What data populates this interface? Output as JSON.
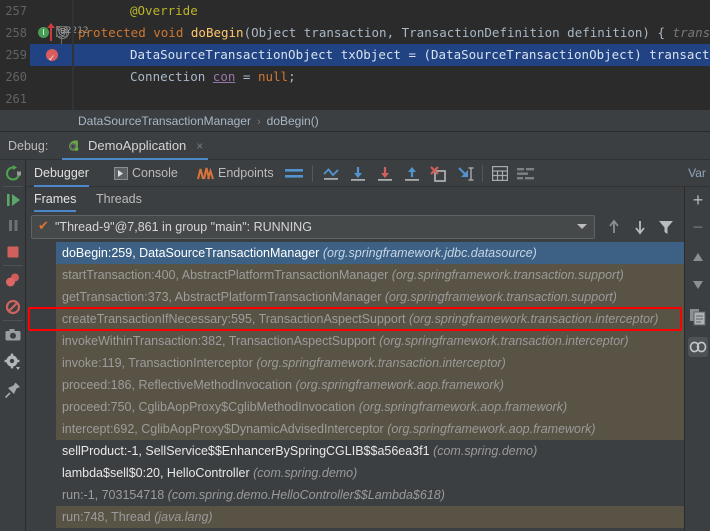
{
  "editor": {
    "lines": [
      {
        "num": "257",
        "segments": [
          {
            "cls": "ann",
            "text": "@Override"
          }
        ],
        "indent": 52
      },
      {
        "num": "258",
        "segments": [
          {
            "cls": "kw",
            "text": "protected void "
          },
          {
            "cls": "mth",
            "text": "doBegin"
          },
          {
            "cls": "pln",
            "text": "(Object transaction, TransactionDefinition definition) { "
          },
          {
            "cls": "hint",
            "text": " transa"
          }
        ],
        "indent": 0
      },
      {
        "num": "259",
        "segments": [
          {
            "cls": "pln",
            "text": "DataSourceTransactionObject txObject = (DataSourceTransactionObject) transaction;"
          }
        ],
        "indent": 22
      },
      {
        "num": "260",
        "segments": [
          {
            "cls": "pln",
            "text": "Connection "
          },
          {
            "cls": "fld",
            "text": "con"
          },
          {
            "cls": "pln",
            "text": " = "
          },
          {
            "cls": "kw",
            "text": "null"
          },
          {
            "cls": "pln",
            "text": ";"
          }
        ],
        "indent": 22
      },
      {
        "num": "261",
        "segments": [],
        "indent": 22
      }
    ]
  },
  "breadcrumb": {
    "class_name": "DataSourceTransactionManager",
    "separator": "›",
    "method_name": "doBegin()"
  },
  "debug_bar": {
    "label": "Debug:",
    "run_config": "DemoApplication",
    "close_glyph": "×"
  },
  "tabs": {
    "main": [
      {
        "label": "Debugger",
        "active": true
      },
      {
        "label": "Console",
        "active": false
      },
      {
        "label": "Endpoints",
        "active": false
      }
    ],
    "sub": [
      {
        "label": "Frames",
        "active": true
      },
      {
        "label": "Threads",
        "active": false
      }
    ],
    "variables_header": "Var"
  },
  "thread_selector": {
    "value": "\"Thread-9\"@7,861 in group \"main\": RUNNING",
    "check_glyph": "✔"
  },
  "frames": [
    {
      "method": "doBegin:259, DataSourceTransactionManager",
      "package": "(org.springframework.jdbc.datasource)",
      "state": "selected"
    },
    {
      "method": "startTransaction:400, AbstractPlatformTransactionManager",
      "package": "(org.springframework.transaction.support)",
      "state": "lib"
    },
    {
      "method": "getTransaction:373, AbstractPlatformTransactionManager",
      "package": "(org.springframework.transaction.support)",
      "state": "lib"
    },
    {
      "method": "createTransactionIfNecessary:595, TransactionAspectSupport",
      "package": "(org.springframework.transaction.interceptor)",
      "state": "lib"
    },
    {
      "method": "invokeWithinTransaction:382, TransactionAspectSupport",
      "package": "(org.springframework.transaction.interceptor)",
      "state": "lib"
    },
    {
      "method": "invoke:119, TransactionInterceptor",
      "package": "(org.springframework.transaction.interceptor)",
      "state": "lib"
    },
    {
      "method": "proceed:186, ReflectiveMethodInvocation",
      "package": "(org.springframework.aop.framework)",
      "state": "lib"
    },
    {
      "method": "proceed:750, CglibAopProxy$CglibMethodInvocation",
      "package": "(org.springframework.aop.framework)",
      "state": "lib"
    },
    {
      "method": "intercept:692, CglibAopProxy$DynamicAdvisedInterceptor",
      "package": "(org.springframework.aop.framework)",
      "state": "lib"
    },
    {
      "method": "sellProduct:-1, SellService$$EnhancerBySpringCGLIB$$a56ea3f1",
      "package": "(com.spring.demo)",
      "state": "user"
    },
    {
      "method": "lambda$sell$0:20, HelloController",
      "package": "(com.spring.demo)",
      "state": "user"
    },
    {
      "method": "run:-1, 703154718",
      "package": "(com.spring.demo.HelloController$$Lambda$618)",
      "state": "user"
    },
    {
      "method": "run:748, Thread",
      "package": "(java.lang)",
      "state": "lib"
    }
  ],
  "annotation": {
    "highlight_color": "#FF0000",
    "highlighted_frame_index": 3
  },
  "left_toolbar": [
    {
      "name": "rerun-icon",
      "glyph": "↻"
    },
    {
      "name": "resume-program-icon",
      "glyph": "▶"
    },
    {
      "name": "pause-program-icon",
      "glyph": "‖"
    },
    {
      "name": "stop-icon",
      "glyph": "■"
    },
    {
      "name": "view-breakpoints-icon",
      "glyph": "●"
    },
    {
      "name": "mute-breakpoints-icon",
      "glyph": "⊘"
    },
    {
      "name": "camera-icon",
      "glyph": "▣"
    },
    {
      "name": "settings-gear-icon",
      "glyph": "⚙"
    },
    {
      "name": "pin-icon",
      "glyph": "⚑"
    }
  ],
  "step_toolbar": [
    {
      "name": "show-execution-point-icon"
    },
    {
      "name": "step-over-icon"
    },
    {
      "name": "step-into-icon"
    },
    {
      "name": "step-out-icon"
    },
    {
      "name": "force-step-into-icon"
    },
    {
      "name": "run-to-cursor-icon"
    },
    {
      "name": "evaluate-expression-icon"
    },
    {
      "name": "layout-settings-icon"
    }
  ],
  "frame_nav": [
    {
      "name": "step-up-frame-icon",
      "glyph": "↑"
    },
    {
      "name": "step-down-frame-icon",
      "glyph": "↓"
    },
    {
      "name": "filter-frames-icon",
      "glyph": "▼"
    }
  ],
  "variables_toolbar": [
    {
      "name": "add-watch-icon",
      "glyph": "+"
    },
    {
      "name": "remove-watch-icon",
      "glyph": "−"
    },
    {
      "name": "move-up-icon",
      "glyph": "▲"
    },
    {
      "name": "move-down-icon",
      "glyph": "▼"
    },
    {
      "name": "copy-value-icon",
      "glyph": "❐"
    },
    {
      "name": "watches-icon",
      "glyph": "∞"
    }
  ],
  "colors": {
    "editor_bg": "#2B2B2B",
    "panel_bg": "#3C3F41",
    "accent_blue": "#4A88C7",
    "selected_row": "#3D6185",
    "library_frame": "#595345",
    "highlight_red": "#FF0000"
  }
}
